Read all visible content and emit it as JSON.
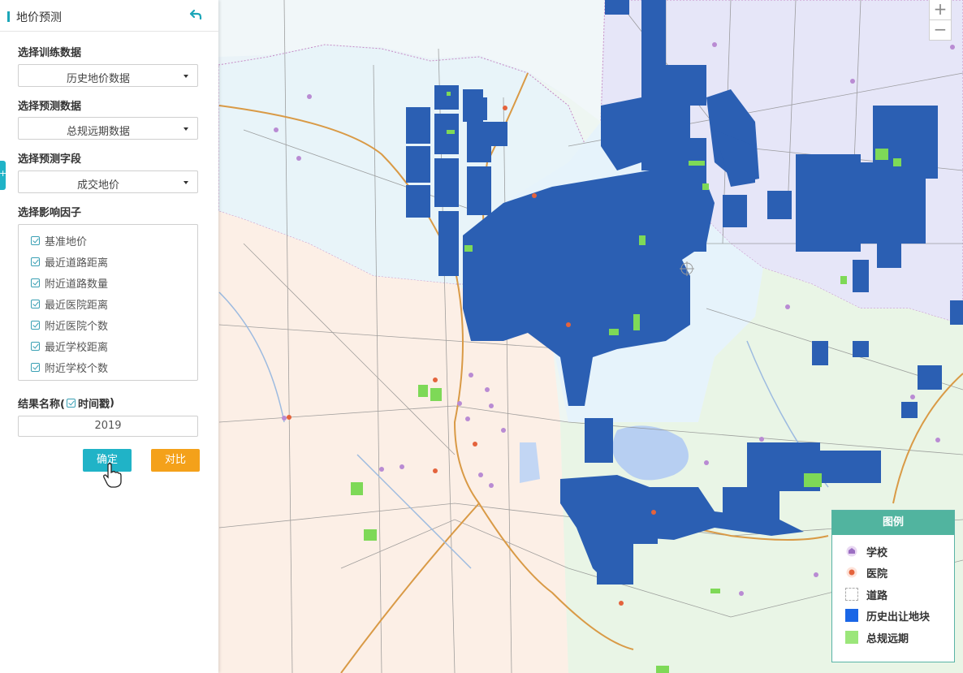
{
  "panel": {
    "title": "地价预测",
    "train_label": "选择训练数据",
    "train_value": "历史地价数据",
    "predict_label": "选择预测数据",
    "predict_value": "总规远期数据",
    "field_label": "选择预测字段",
    "field_value": "成交地价",
    "factors_label": "选择影响因子",
    "factors": [
      "基准地价",
      "最近道路距离",
      "附近道路数量",
      "最近医院距离",
      "附近医院个数",
      "最近学校距离",
      "附近学校个数"
    ],
    "result_label_prefix": "结果名称(",
    "result_timestamp": "时间戳",
    "result_label_suffix": ")",
    "result_value": "2019",
    "ok_button": "确定",
    "compare_button": "对比",
    "side_tab": "+"
  },
  "zoom": {
    "in": "+",
    "out": "−"
  },
  "legend": {
    "title": "图例",
    "items": [
      {
        "label": "学校",
        "icon": "school-icon"
      },
      {
        "label": "医院",
        "icon": "hospital-icon"
      },
      {
        "label": "道路",
        "icon": "road-icon"
      },
      {
        "label": "历史出让地块",
        "color": "#1a66e6"
      },
      {
        "label": "总规远期",
        "color": "#9be67a"
      }
    ]
  },
  "colors": {
    "accent": "#20b3c7",
    "compare": "#f4a11a",
    "parcel": "#2b5fb3",
    "plan": "#7ed957"
  }
}
